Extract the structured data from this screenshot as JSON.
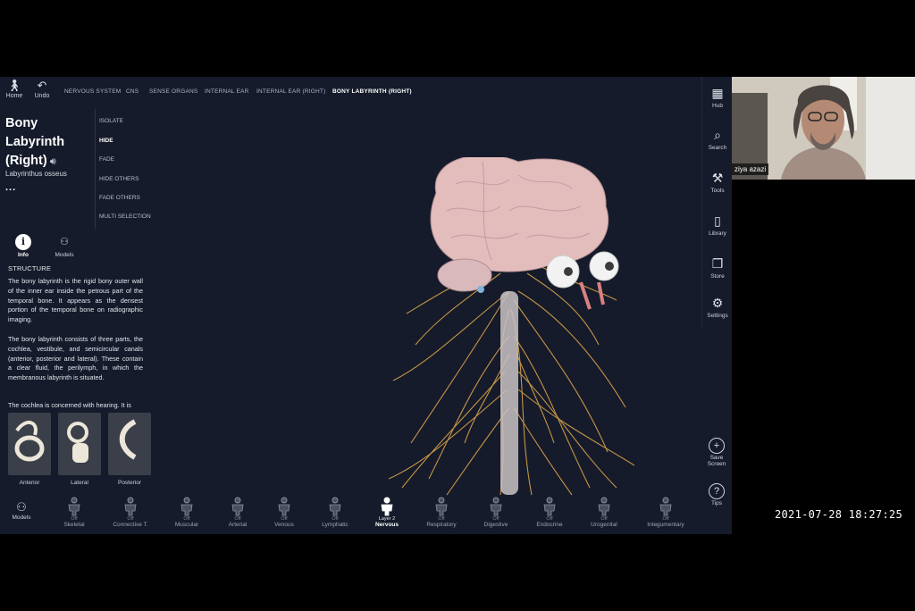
{
  "topnav": {
    "home_label": "Home",
    "undo_label": "Undo",
    "breadcrumbs": [
      "NERVOUS SYSTEM",
      "CNS",
      "SENSE ORGANS",
      "INTERNAL EAR",
      "INTERNAL EAR (RIGHT)",
      "BONY LABYRINTH (RIGHT)"
    ]
  },
  "structure": {
    "title_line1": "Bony",
    "title_line2": "Labyrinth",
    "title_line3": "(Right)",
    "latin_name": "Labyrinthus osseus",
    "more": "..."
  },
  "actions": [
    "ISOLATE",
    "HIDE",
    "FADE",
    "HIDE OTHERS",
    "FADE OTHERS",
    "MULTI SELECTION"
  ],
  "tabs": {
    "info": "Info",
    "models": "Models"
  },
  "info": {
    "heading": "STRUCTURE",
    "p1": "The bony labyrinth is the rigid bony outer wall of the inner ear inside the petrous part of the temporal bone. It appears as the densest portion of the temporal bone on radiographic imaging.",
    "p2": "The bony labyrinth consists of three parts, the cochlea, vestibule, and semicircular canals (anterior, posterior and lateral). These contain a clear fluid, the perilymph, in which the membranous labyrinth is situated.",
    "p3": "The cochlea is concerned with hearing. It is"
  },
  "thumbnails": [
    "Anterior",
    "Lateral",
    "Posterior"
  ],
  "bottombar": {
    "models_label": "Models",
    "systems": [
      {
        "state": "Off",
        "label": "Skeletal"
      },
      {
        "state": "Off",
        "label": "Connective T."
      },
      {
        "state": "Off",
        "label": "Muscular"
      },
      {
        "state": "Off",
        "label": "Arterial"
      },
      {
        "state": "Off",
        "label": "Venous"
      },
      {
        "state": "Off",
        "label": "Lymphatic"
      },
      {
        "state": "Layer 2",
        "label": "Nervous"
      },
      {
        "state": "Off",
        "label": "Respiratory"
      },
      {
        "state": "Off",
        "label": "Digestive"
      },
      {
        "state": "Off",
        "label": "Endocrine"
      },
      {
        "state": "Off",
        "label": "Urogenital"
      },
      {
        "state": "Off",
        "label": "Integumentary"
      }
    ]
  },
  "rightbar": {
    "hub": "Hub",
    "search": "Search",
    "tools": "Tools",
    "library": "Library",
    "store": "Store",
    "settings": "Settings",
    "save_screen_line1": "Save",
    "save_screen_line2": "Screen",
    "tips": "Tips"
  },
  "webcam": {
    "participant_name": "ziya azazi"
  },
  "recording": {
    "timestamp": "2021-07-28  18:27:25"
  },
  "colors": {
    "app_bg": "#151b2a",
    "nerve": "#d9a24a",
    "brain": "#e3bcbc"
  }
}
